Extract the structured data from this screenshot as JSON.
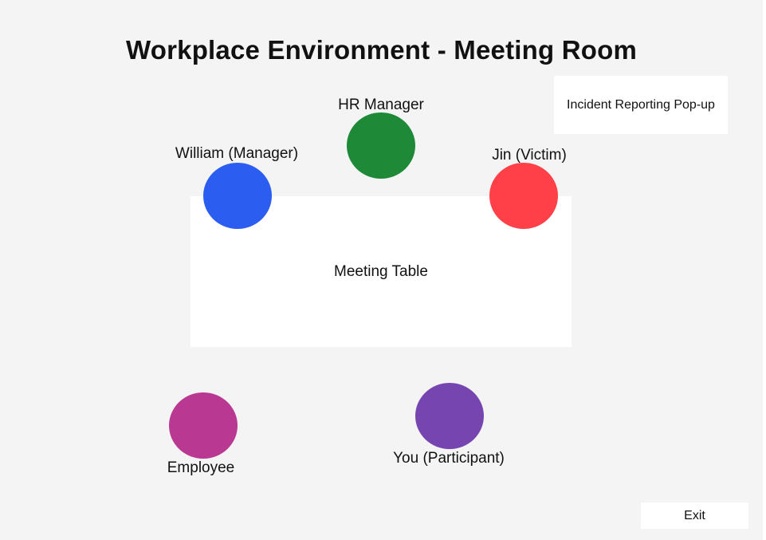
{
  "title": "Workplace Environment - Meeting Room",
  "popup": {
    "label": "Incident Reporting Pop-up"
  },
  "table": {
    "label": "Meeting Table"
  },
  "characters": {
    "hr_manager": {
      "label": "HR Manager",
      "color": "#1e8a38"
    },
    "william": {
      "label": "William (Manager)",
      "color": "#2b5ef0"
    },
    "jin": {
      "label": "Jin (Victim)",
      "color": "#ff4048"
    },
    "employee": {
      "label": "Employee",
      "color": "#b93891"
    },
    "you": {
      "label": "You (Participant)",
      "color": "#7645b0"
    }
  },
  "exit": {
    "label": "Exit"
  }
}
